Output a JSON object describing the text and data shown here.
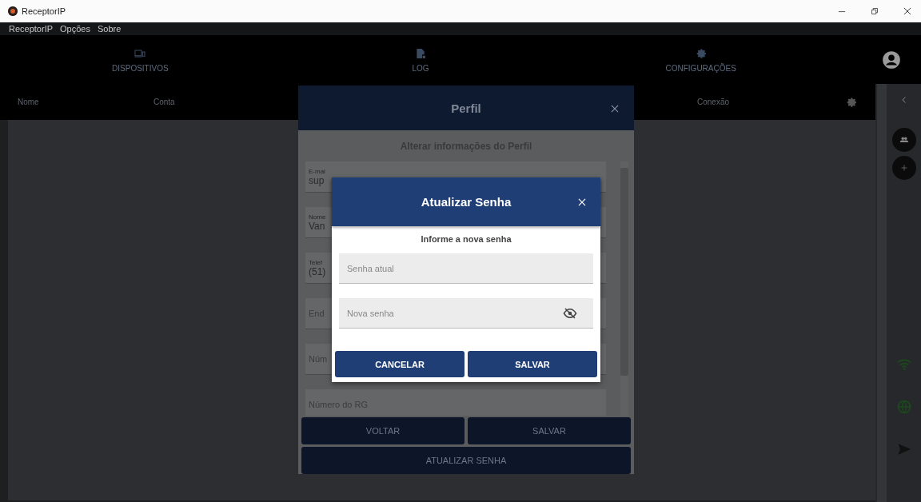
{
  "window": {
    "title": "ReceptorIP"
  },
  "menu": [
    "ReceptorIP",
    "Opções",
    "Sobre"
  ],
  "nav_tabs": [
    {
      "label": "DISPOSITIVOS",
      "kind": "devices"
    },
    {
      "label": "LOG",
      "kind": "log"
    },
    {
      "label": "CONFIGURAÇÕES",
      "kind": "settings"
    }
  ],
  "table": {
    "columns": [
      "Nome",
      "Conta",
      "Conexão"
    ]
  },
  "profile_dialog": {
    "title": "Perfil",
    "subtitle": "Alterar informações do Perfil",
    "fields": [
      {
        "kind": "labeled",
        "label": "E-mai",
        "value": "sup"
      },
      {
        "kind": "labeled",
        "label": "Nome",
        "value": "Van"
      },
      {
        "kind": "labeled",
        "label": "Telef",
        "value": "(51)"
      },
      {
        "kind": "placeholder",
        "placeholder": "End"
      },
      {
        "kind": "placeholder",
        "placeholder": "Núm"
      },
      {
        "kind": "placeholder",
        "placeholder": "Número do RG"
      }
    ],
    "buttons": [
      "VOLTAR",
      "SALVAR"
    ],
    "wide_button": "ATUALIZAR SENHA"
  },
  "password_dialog": {
    "title": "Atualizar Senha",
    "subtitle": "Informe a nova senha",
    "fields": [
      {
        "placeholder": "Senha atual",
        "reveal_toggle": false
      },
      {
        "placeholder": "Nova senha",
        "reveal_toggle": true
      }
    ],
    "buttons": [
      "CANCELAR",
      "SALVAR"
    ]
  }
}
